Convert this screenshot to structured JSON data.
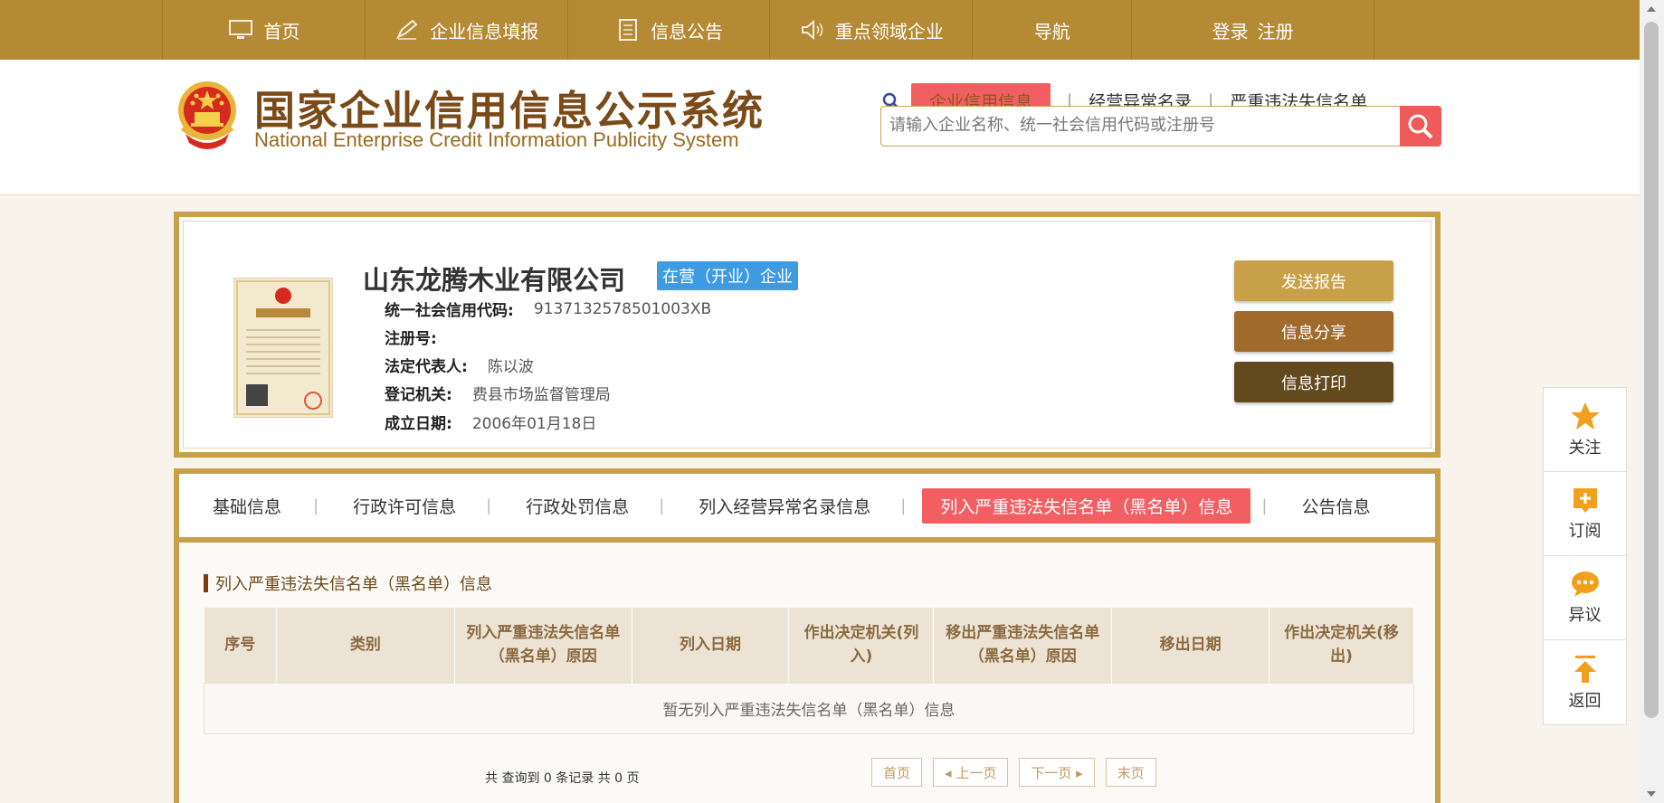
{
  "nav": {
    "items": [
      {
        "label": "首页",
        "icon": "monitor-icon"
      },
      {
        "label": "企业信息填报",
        "icon": "pen-icon"
      },
      {
        "label": "信息公告",
        "icon": "document-icon"
      },
      {
        "label": "重点领域企业",
        "icon": "speaker-icon"
      },
      {
        "label": "导航",
        "icon": ""
      }
    ],
    "login": "登录",
    "register": "注册"
  },
  "header": {
    "title_cn": "国家企业信用信息公示系统",
    "title_en": "National Enterprise Credit Information Publicity System",
    "search_tabs": [
      "企业信用信息",
      "经营异常名录",
      "严重违法失信名单"
    ],
    "search_placeholder": "请输入企业名称、统一社会信用代码或注册号"
  },
  "company": {
    "name": "山东龙腾木业有限公司",
    "status": "在营（开业）企业",
    "fields": [
      {
        "label": "统一社会信用代码:",
        "value": "9137132578501003XB"
      },
      {
        "label": "注册号:",
        "value": ""
      },
      {
        "label": "法定代表人:",
        "value": "陈以波"
      },
      {
        "label": "登记机关:",
        "value": "费县市场监督管理局"
      },
      {
        "label": "成立日期:",
        "value": "2006年01月18日"
      }
    ],
    "buttons": [
      "发送报告",
      "信息分享",
      "信息打印"
    ]
  },
  "tabs": [
    "基础信息",
    "行政许可信息",
    "行政处罚信息",
    "列入经营异常名录信息",
    "列入严重违法失信名单（黑名单）信息",
    "公告信息"
  ],
  "active_tab": 4,
  "section": {
    "title": "列入严重违法失信名单（黑名单）信息",
    "columns": [
      "序号",
      "类别",
      "列入严重违法失信名单（黑名单）原因",
      "列入日期",
      "作出决定机关(列入)",
      "移出严重违法失信名单（黑名单）原因",
      "移出日期",
      "作出决定机关(移出)"
    ],
    "empty_text": "暂无列入严重违法失信名单（黑名单）信息",
    "pager_info": "共 查询到 0 条记录 共 0 页",
    "pager": [
      "首页",
      "◂ 上一页",
      "下一页 ▸",
      "末页"
    ]
  },
  "side": [
    "关注",
    "订阅",
    "异议",
    "返回"
  ],
  "colors": {
    "nav_bg": "#b58a34",
    "border_gold": "#c9a04a",
    "active_tab": "#f25f63",
    "badge": "#3e9be2",
    "btn_send": "#c9a04a",
    "btn_share": "#a06a2a",
    "btn_print": "#634a1e"
  }
}
